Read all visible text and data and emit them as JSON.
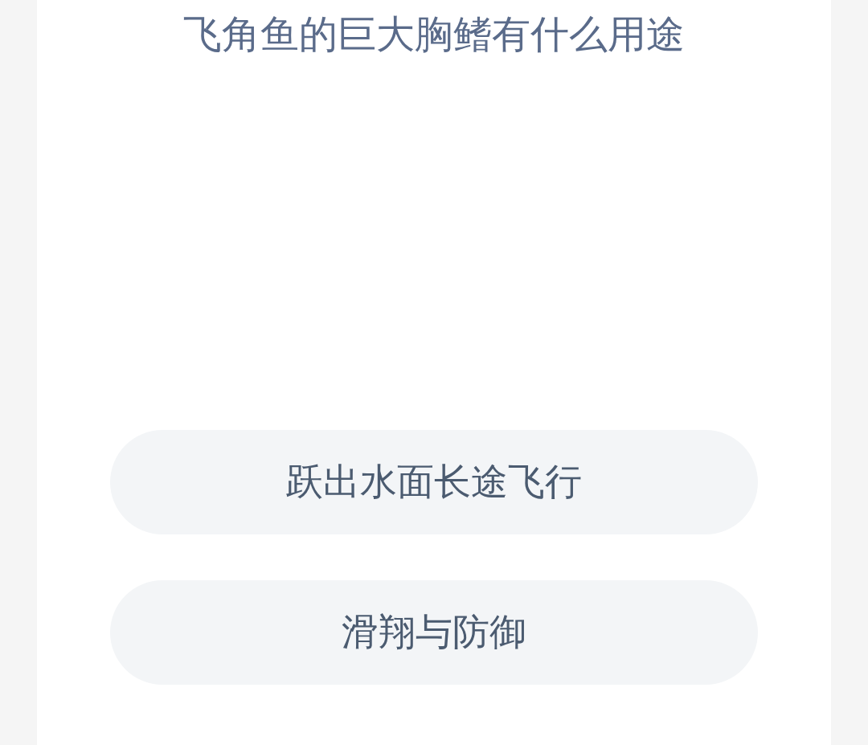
{
  "question": "飞角鱼的巨大胸鳍有什么用途",
  "options": [
    {
      "label": "跃出水面长途飞行"
    },
    {
      "label": "滑翔与防御"
    }
  ]
}
